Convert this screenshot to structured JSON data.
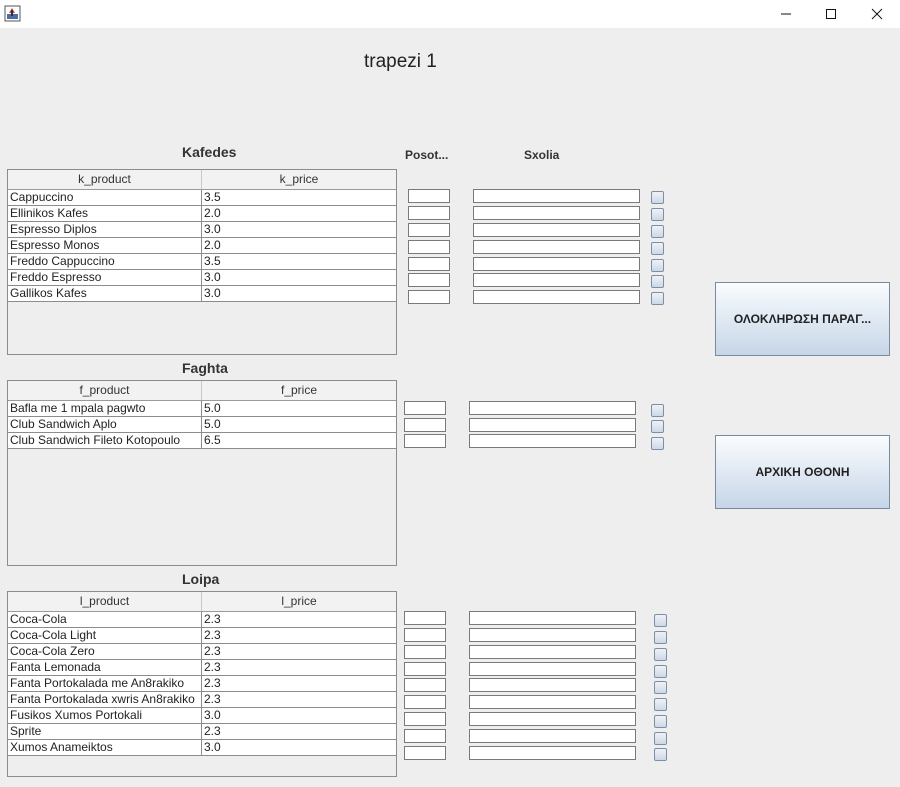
{
  "window": {
    "title": ""
  },
  "page": {
    "title": "trapezi 1"
  },
  "columns": {
    "posotita": "Posot...",
    "sxolia": "Sxolia"
  },
  "sections": [
    {
      "title": "Kafedes",
      "headers": [
        "k_product",
        "k_price"
      ],
      "rows": [
        [
          "Cappuccino",
          "3.5"
        ],
        [
          "Ellinikos Kafes",
          "2.0"
        ],
        [
          "Espresso Diplos",
          "3.0"
        ],
        [
          "Espresso Monos",
          "2.0"
        ],
        [
          "Freddo Cappuccino",
          "3.5"
        ],
        [
          "Freddo Espresso",
          "3.0"
        ],
        [
          "Gallikos Kafes",
          "3.0"
        ]
      ]
    },
    {
      "title": "Faghta",
      "headers": [
        "f_product",
        "f_price"
      ],
      "rows": [
        [
          "Bafla me 1 mpala pagwto",
          "5.0"
        ],
        [
          "Club Sandwich Aplo",
          "5.0"
        ],
        [
          "Club Sandwich Fileto Kotopoulo",
          "6.5"
        ]
      ]
    },
    {
      "title": "Loipa",
      "headers": [
        "l_product",
        "l_price"
      ],
      "rows": [
        [
          "Coca-Cola",
          "2.3"
        ],
        [
          "Coca-Cola Light",
          "2.3"
        ],
        [
          "Coca-Cola Zero",
          "2.3"
        ],
        [
          "Fanta Lemonada",
          "2.3"
        ],
        [
          "Fanta Portokalada me An8rakiko",
          "2.3"
        ],
        [
          "Fanta Portokalada xwris An8rakiko",
          "2.3"
        ],
        [
          "Fusikos Xumos Portokali",
          "3.0"
        ],
        [
          "Sprite",
          "2.3"
        ],
        [
          "Xumos Anameiktos",
          "3.0"
        ]
      ]
    }
  ],
  "buttons": {
    "complete_order": "ΟΛΟΚΛΗΡΩΣΗ ΠΑΡΑΓ...",
    "home_screen": "ΑΡΧΙΚΗ ΟΘΟΝΗ"
  },
  "icons": {
    "app": "java-app-icon",
    "minimize": "minimize-icon",
    "maximize": "maximize-icon",
    "close": "close-icon"
  }
}
